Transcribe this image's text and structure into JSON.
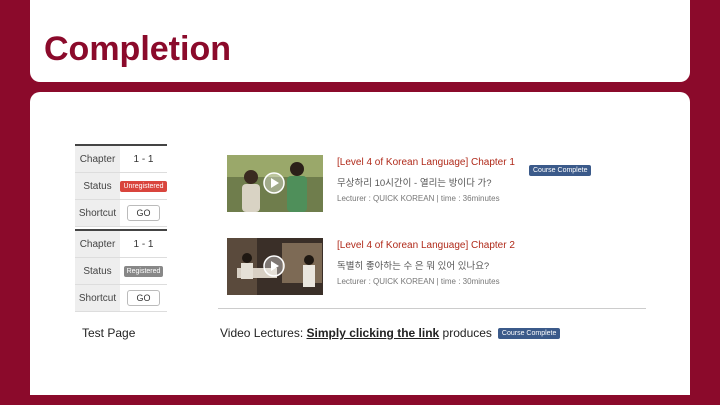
{
  "slide": {
    "title": "Completion"
  },
  "left_tables": [
    {
      "chapter_label": "Chapter",
      "chapter_value": "1 - 1",
      "status_label": "Status",
      "status_value": "Unregistered",
      "shortcut_label": "Shortcut",
      "shortcut_button": "GO"
    },
    {
      "chapter_label": "Chapter",
      "chapter_value": "1 - 1",
      "status_label": "Status",
      "status_value": "Registered",
      "shortcut_label": "Shortcut",
      "shortcut_button": "GO"
    }
  ],
  "lectures": [
    {
      "title": "[Level 4 of Korean Language] Chapter 1",
      "subtitle": "무상하리 10시간이 - 열리는 방이다 가?",
      "meta": "Lecturer : QUICK KOREAN | time : 36minutes",
      "badge": "Course Complete"
    },
    {
      "title": "[Level 4 of Korean Language] Chapter 2",
      "subtitle": "독별히 좋아하는 수 은 뭐 있어 있나요?",
      "meta": "Lecturer : QUICK KOREAN | time : 30minutes",
      "badge": ""
    }
  ],
  "captions": {
    "left": "Test Page",
    "right_prefix": "Video Lectures: ",
    "right_link": "Simply clicking the link",
    "right_suffix": " produces",
    "right_badge": "Course Complete"
  },
  "colors": {
    "brand": "#8b0a2b",
    "badge_blue": "#3b5a8a",
    "badge_red": "#d9453d"
  }
}
